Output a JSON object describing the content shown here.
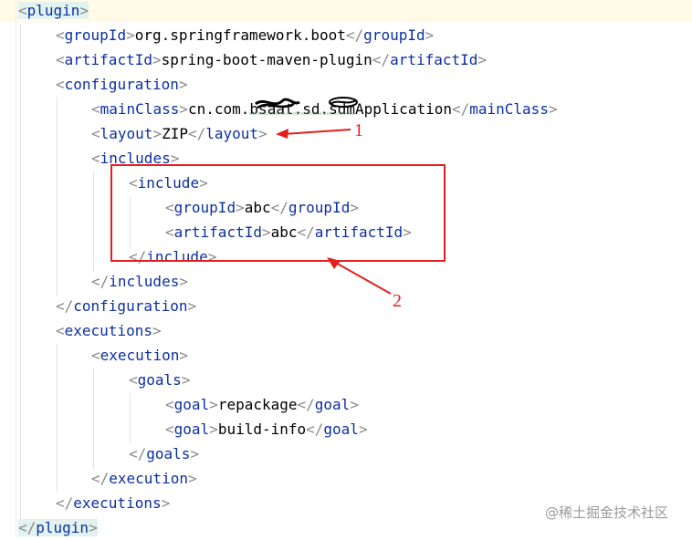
{
  "code": {
    "lines": [
      {
        "open": "plugin"
      },
      {
        "open": "groupId",
        "text": "org.springframework.boot",
        "close": "groupId"
      },
      {
        "open": "artifactId",
        "text": "spring-boot-maven-plugin",
        "close": "artifactId"
      },
      {
        "open": "configuration"
      },
      {
        "open": "mainClass",
        "text_pre": "cn.com.",
        "text_obscured": "bsaat.sd.sdm",
        "text_post": "Application",
        "close": "mainClass"
      },
      {
        "open": "layout",
        "text": "ZIP",
        "close": "layout"
      },
      {
        "open": "includes"
      },
      {
        "open": "include"
      },
      {
        "open": "groupId",
        "text": "abc",
        "close": "groupId"
      },
      {
        "open": "artifactId",
        "text": "abc",
        "close": "artifactId"
      },
      {
        "close": "include"
      },
      {
        "close": "includes"
      },
      {
        "close": "configuration"
      },
      {
        "open": "executions"
      },
      {
        "open": "execution"
      },
      {
        "open": "goals"
      },
      {
        "open": "goal",
        "text": "repackage",
        "close": "goal"
      },
      {
        "open": "goal",
        "text": "build-info",
        "close": "goal"
      },
      {
        "close": "goals"
      },
      {
        "close": "execution"
      },
      {
        "close": "executions"
      },
      {
        "close": "plugin"
      }
    ]
  },
  "annotations": {
    "label_1": "1",
    "label_2": "2",
    "color": "#e41e1e"
  },
  "watermark": "@稀土掘金技术社区",
  "colors": {
    "tag": "#0b2fa3",
    "bracket": "#8a8a8a",
    "caret_line": "#fffbe6",
    "matched_tag_bg": "#e2f2ef"
  }
}
